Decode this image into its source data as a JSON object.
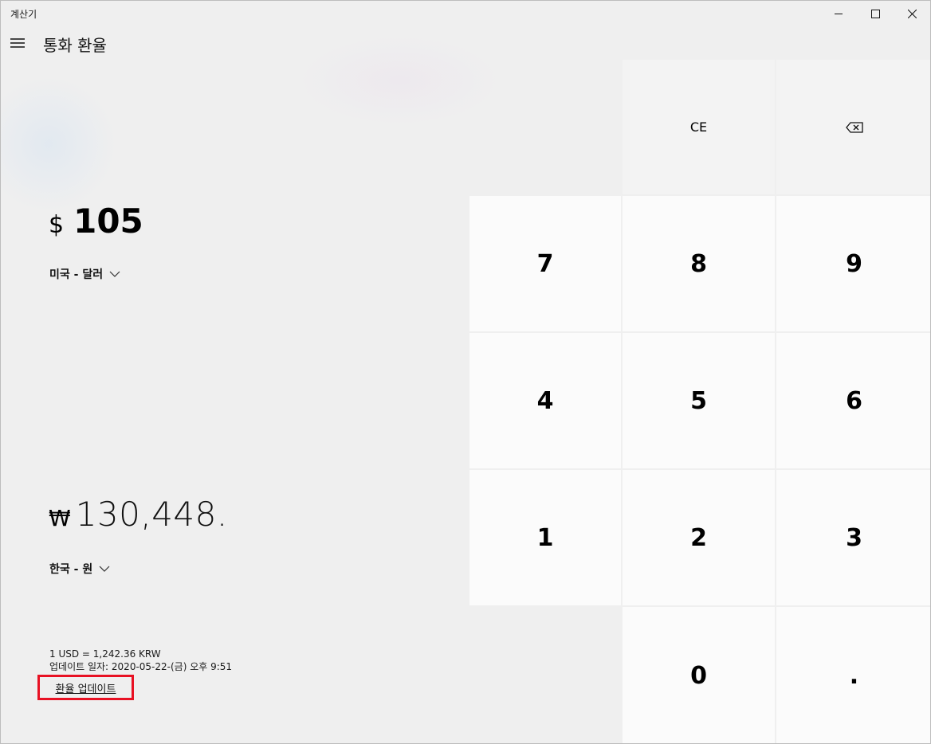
{
  "window": {
    "app_title": "계산기"
  },
  "header": {
    "mode_title": "통화 환율"
  },
  "from": {
    "symbol": "$",
    "amount": "105",
    "unit": "미국 - 달러"
  },
  "to": {
    "symbol": "₩",
    "amount": "130,448.",
    "unit": "한국 - 원"
  },
  "rate": {
    "line1": "1 USD = 1,242.36 KRW",
    "line2": "업데이트 일자: 2020-05-22-(금) 오후 9:51",
    "update_link": "환율 업데이트"
  },
  "keypad": {
    "ce": "CE",
    "backspace_icon": "backspace-icon",
    "k7": "7",
    "k8": "8",
    "k9": "9",
    "k4": "4",
    "k5": "5",
    "k6": "6",
    "k1": "1",
    "k2": "2",
    "k3": "3",
    "k0": "0",
    "decimal": "."
  },
  "colors": {
    "highlight_box": "#e81123",
    "background": "#efefef"
  }
}
